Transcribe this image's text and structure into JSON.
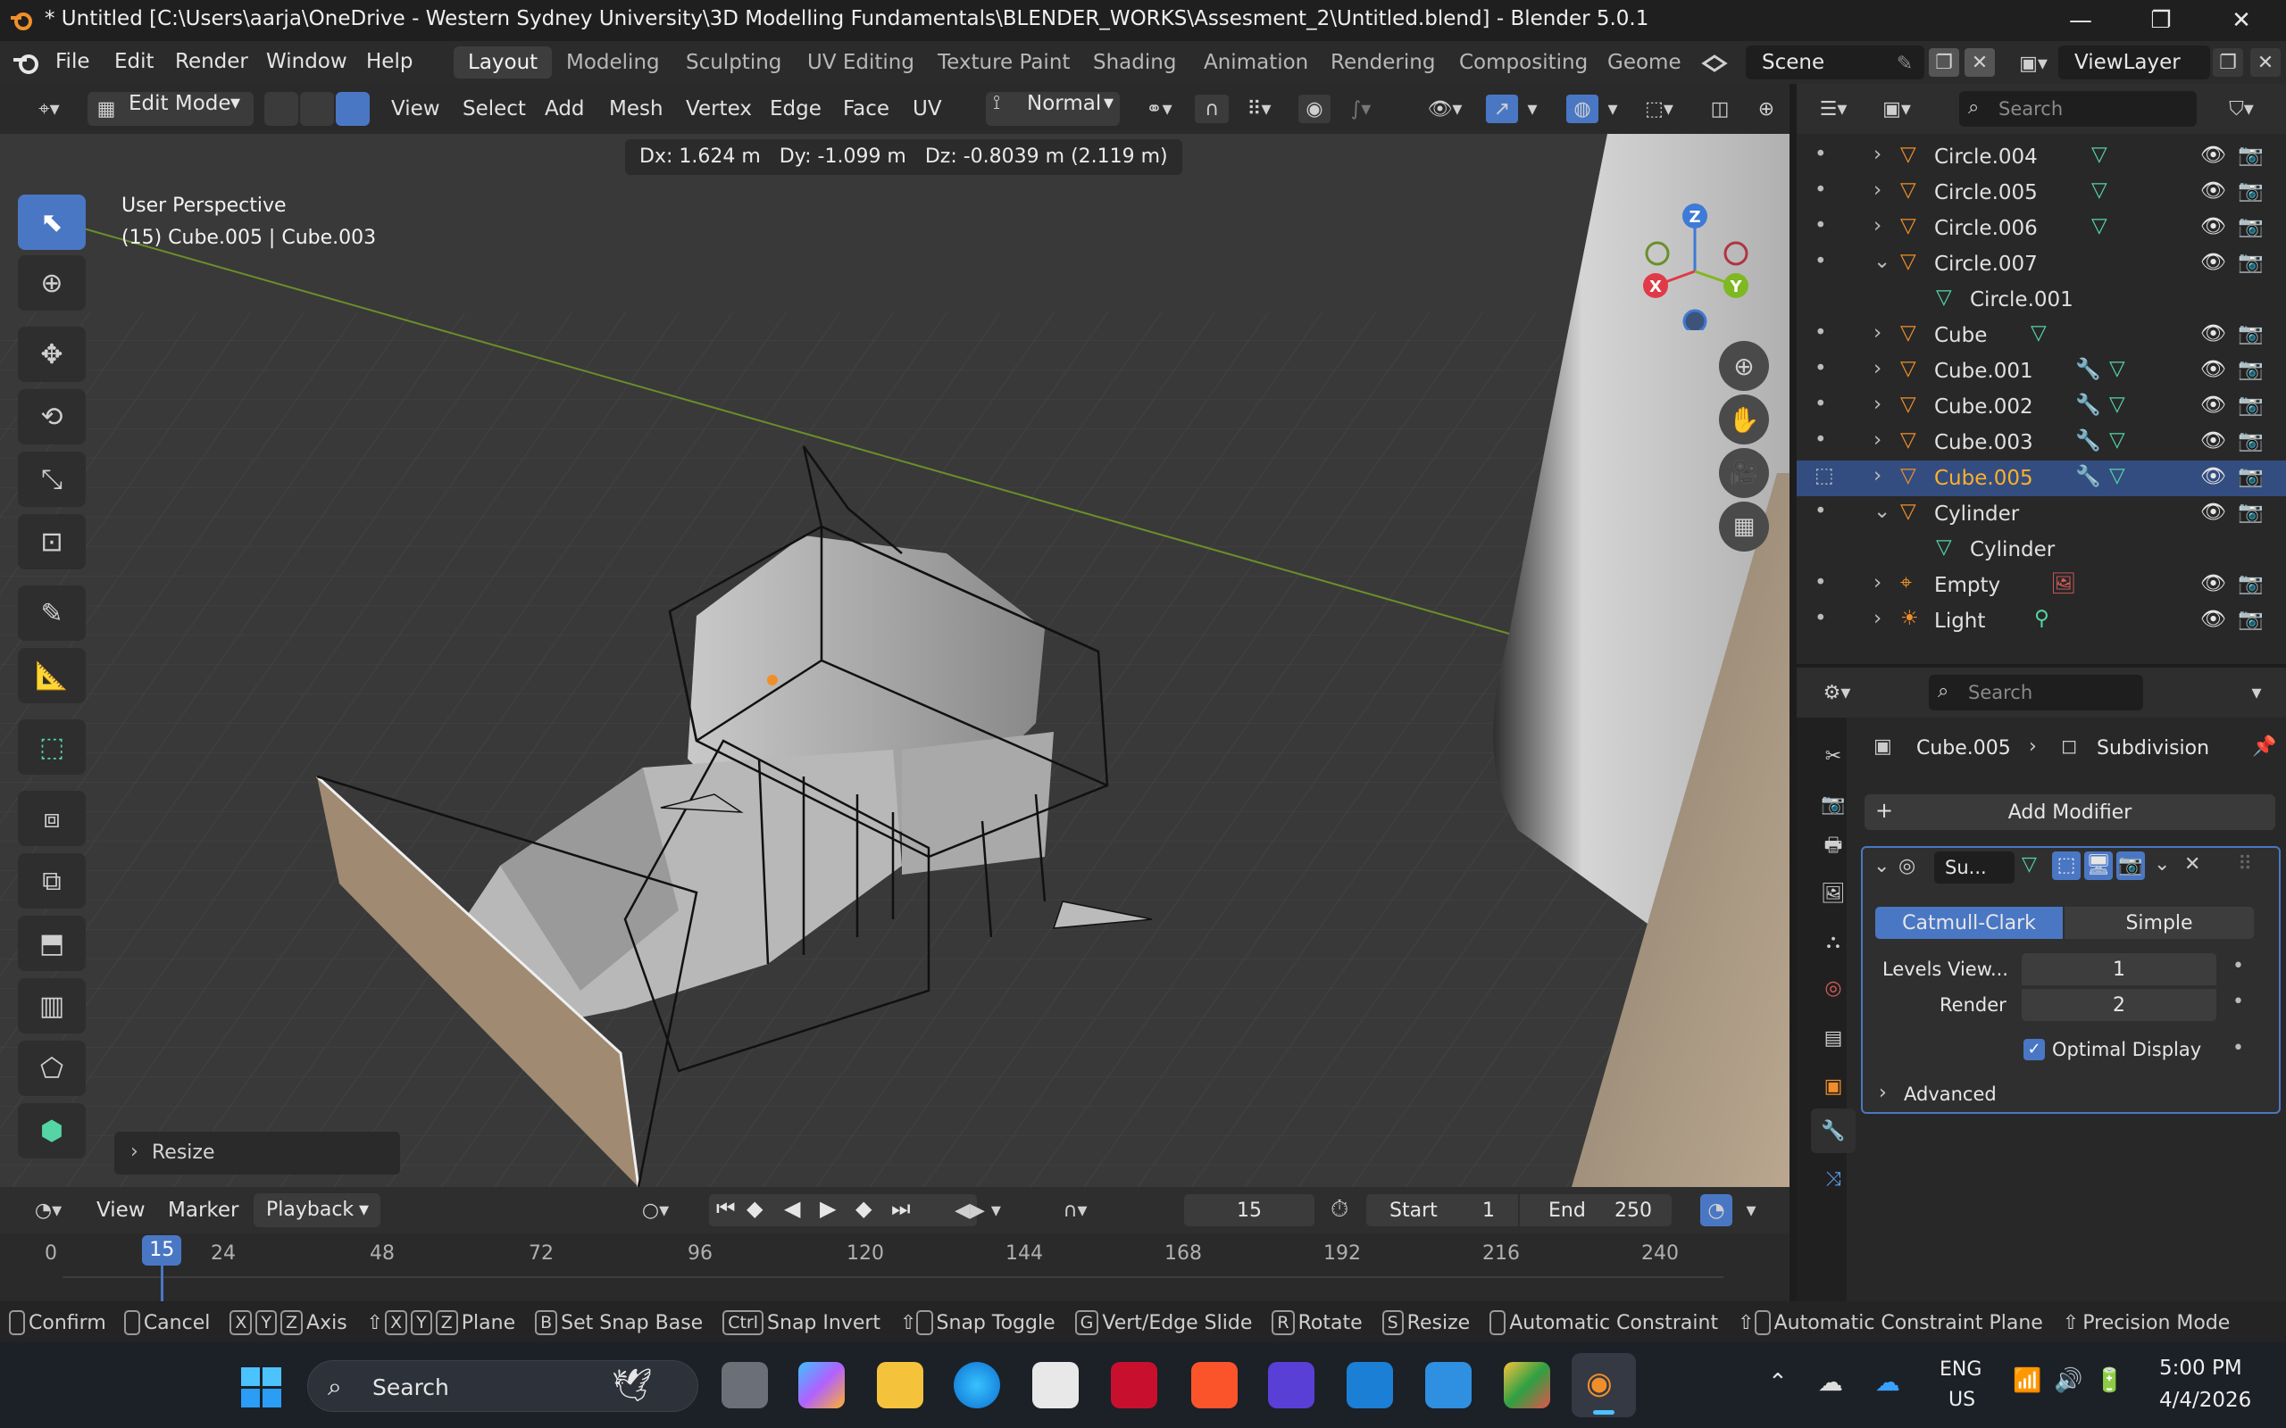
{
  "window": {
    "title": "* Untitled [C:\\Users\\aarja\\OneDrive - Western Sydney University\\3D Modelling Fundamentals\\BLENDER_WORKS\\Assesment_2\\Untitled.blend] - Blender 5.0.1",
    "minimize": "—",
    "maximize": "❐",
    "close": "✕"
  },
  "menubar": {
    "items": [
      "File",
      "Edit",
      "Render",
      "Window",
      "Help"
    ],
    "workspaces": [
      "Layout",
      "Modeling",
      "Sculpting",
      "UV Editing",
      "Texture Paint",
      "Shading",
      "Animation",
      "Rendering",
      "Compositing",
      "Geome"
    ],
    "scene": "Scene",
    "viewlayer": "ViewLayer"
  },
  "viewport_header": {
    "mode": "Edit Mode",
    "menus": [
      "View",
      "Select",
      "Add",
      "Mesh",
      "Vertex",
      "Edge",
      "Face",
      "UV"
    ],
    "orientation": "Normal"
  },
  "viewport": {
    "transform_readout": "Dx: 1.624 m   Dy: -1.099 m   Dz: -0.8039 m (2.119 m)",
    "view_name": "User Perspective",
    "object_info": "(15) Cube.005 | Cube.003",
    "gizmo_axes": [
      "Z",
      "X",
      "Y"
    ],
    "last_operator": "Resize"
  },
  "outliner": {
    "search_placeholder": "Search",
    "rows": [
      {
        "name": "Circle.004",
        "expanded": false,
        "indent": 0,
        "type": "mesh"
      },
      {
        "name": "Circle.005",
        "expanded": false,
        "indent": 0,
        "type": "mesh"
      },
      {
        "name": "Circle.006",
        "expanded": false,
        "indent": 0,
        "type": "mesh"
      },
      {
        "name": "Circle.007",
        "expanded": true,
        "indent": 0,
        "type": "mesh"
      },
      {
        "name": "Circle.001",
        "expanded": false,
        "indent": 1,
        "type": "data"
      },
      {
        "name": "Cube",
        "expanded": false,
        "indent": 0,
        "type": "mesh"
      },
      {
        "name": "Cube.001",
        "expanded": false,
        "indent": 0,
        "type": "mesh"
      },
      {
        "name": "Cube.002",
        "expanded": false,
        "indent": 0,
        "type": "mesh"
      },
      {
        "name": "Cube.003",
        "expanded": false,
        "indent": 0,
        "type": "mesh"
      },
      {
        "name": "Cube.005",
        "expanded": false,
        "indent": 0,
        "type": "mesh",
        "selected": true
      },
      {
        "name": "Cylinder",
        "expanded": true,
        "indent": 0,
        "type": "mesh"
      },
      {
        "name": "Cylinder",
        "expanded": false,
        "indent": 1,
        "type": "data"
      },
      {
        "name": "Empty",
        "expanded": false,
        "indent": 0,
        "type": "empty"
      },
      {
        "name": "Light",
        "expanded": false,
        "indent": 0,
        "type": "light"
      }
    ]
  },
  "properties": {
    "search_placeholder": "Search",
    "breadcrumb_object": "Cube.005",
    "breadcrumb_modifier": "Subdivision",
    "add_modifier": "Add Modifier",
    "modifier_name": "Su...",
    "subdiv_types": [
      "Catmull-Clark",
      "Simple"
    ],
    "levels_label": "Levels View...",
    "levels_value": "1",
    "render_label": "Render",
    "render_value": "2",
    "optimal_display": "Optimal Display",
    "advanced": "Advanced"
  },
  "timeline": {
    "menus": [
      "View",
      "Marker",
      "Playback"
    ],
    "current_frame": "15",
    "start_label": "Start",
    "start_value": "1",
    "end_label": "End",
    "end_value": "250",
    "ruler": [
      "0",
      "24",
      "48",
      "72",
      "96",
      "120",
      "144",
      "168",
      "192",
      "216",
      "240"
    ],
    "playhead": "15"
  },
  "statusbar": {
    "items": [
      "Confirm",
      "Cancel",
      "Axis",
      "Plane",
      "Set Snap Base",
      "Snap Invert",
      "Snap Toggle",
      "Vert/Edge Slide",
      "Rotate",
      "Resize",
      "Automatic Constraint",
      "Automatic Constraint Plane",
      "Precision Mode"
    ],
    "keys_axis": [
      "X",
      "Y",
      "Z"
    ],
    "keys_plane": [
      "X",
      "Y",
      "Z"
    ],
    "key_snap_base": "B",
    "key_snap_invert": "Ctrl",
    "key_slide": "G",
    "key_rotate": "R",
    "key_resize": "S"
  },
  "taskbar": {
    "search": "Search",
    "lang": "ENG",
    "region": "US",
    "time": "5:00 PM",
    "date": "4/4/2026"
  }
}
